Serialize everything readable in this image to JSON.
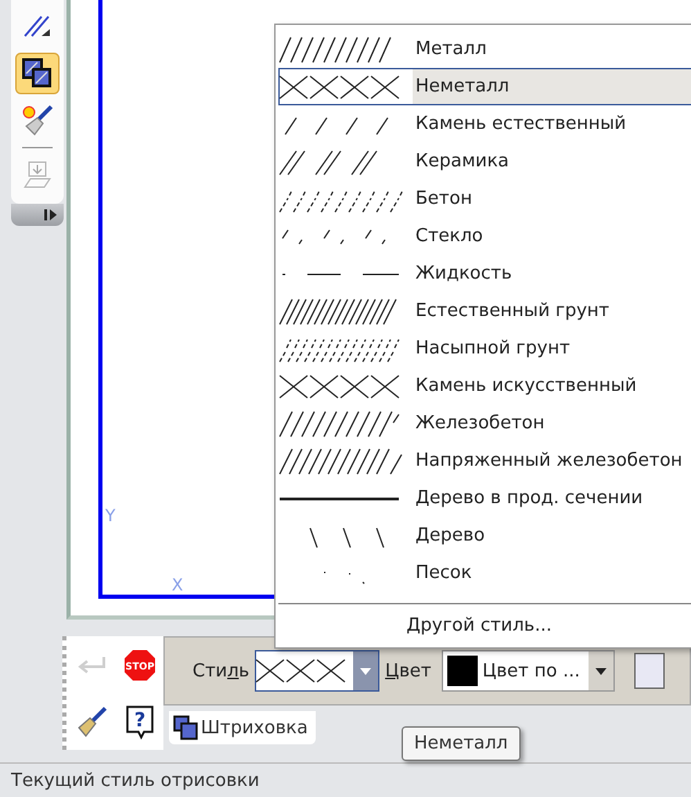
{
  "toolbar": {
    "buttons": [
      {
        "kind": "lines",
        "selected": false,
        "disabled": false
      },
      {
        "kind": "hatch",
        "selected": true,
        "disabled": false
      },
      {
        "kind": "brush",
        "selected": false,
        "disabled": false
      },
      {
        "kind": "insert",
        "selected": false,
        "disabled": true
      }
    ]
  },
  "canvas": {
    "axis_labels": [
      "Y",
      "X"
    ]
  },
  "menu": {
    "items": [
      {
        "label": "Металл",
        "kind": "metal",
        "selected": false
      },
      {
        "label": "Неметалл",
        "kind": "cross",
        "selected": true
      },
      {
        "label": "Камень естественный",
        "kind": "stone",
        "selected": false
      },
      {
        "label": "Керамика",
        "kind": "ceramic",
        "selected": false
      },
      {
        "label": "Бетон",
        "kind": "concrete",
        "selected": false
      },
      {
        "label": "Стекло",
        "kind": "glass",
        "selected": false
      },
      {
        "label": "Жидкость",
        "kind": "liquid",
        "selected": false
      },
      {
        "label": "Естественный грунт",
        "kind": "soil",
        "selected": false
      },
      {
        "label": "Насыпной грунт",
        "kind": "fill",
        "selected": false
      },
      {
        "label": "Камень искусственный",
        "kind": "cross",
        "selected": false
      },
      {
        "label": "Железобетон",
        "kind": "reinforced",
        "selected": false
      },
      {
        "label": "Напряженный железобетон",
        "kind": "prestressed",
        "selected": false
      },
      {
        "label": "Дерево в прод. сечении",
        "kind": "solid",
        "selected": false
      },
      {
        "label": "Дерево",
        "kind": "wood",
        "selected": false
      },
      {
        "label": "Песок",
        "kind": "sand",
        "selected": false
      }
    ],
    "footer": "Другой стиль..."
  },
  "panel": {
    "buttons": [
      {
        "kind": "enter",
        "disabled": true
      },
      {
        "kind": "stop",
        "text": "STOP",
        "disabled": false
      },
      {
        "kind": "brush",
        "disabled": false
      },
      {
        "kind": "help",
        "text": "?",
        "disabled": false
      }
    ],
    "style_label": {
      "before": "Сти",
      "mnemonic": "л",
      "after": "ь"
    },
    "style_field": {
      "kind": "cross"
    },
    "color_label": {
      "mnemonic": "Ц",
      "after": "вет"
    },
    "color_field": {
      "color": "#000000"
    },
    "color_value": "Цвет по ...",
    "tab": "Штриховка"
  },
  "tooltip": "Неметалл",
  "status_bar": "Текущий стиль отрисовки"
}
